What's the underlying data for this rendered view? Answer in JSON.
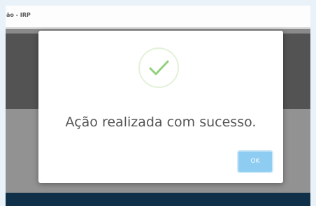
{
  "window": {
    "title": "ão - IRP"
  },
  "dialog": {
    "message": "Ação realizada com sucesso.",
    "ok_label": "OK",
    "icon": "success-check-icon"
  },
  "colors": {
    "bottom_bar": "#1c4f79",
    "ok_button": "#8ecdf1",
    "check": "#8fd07a"
  }
}
